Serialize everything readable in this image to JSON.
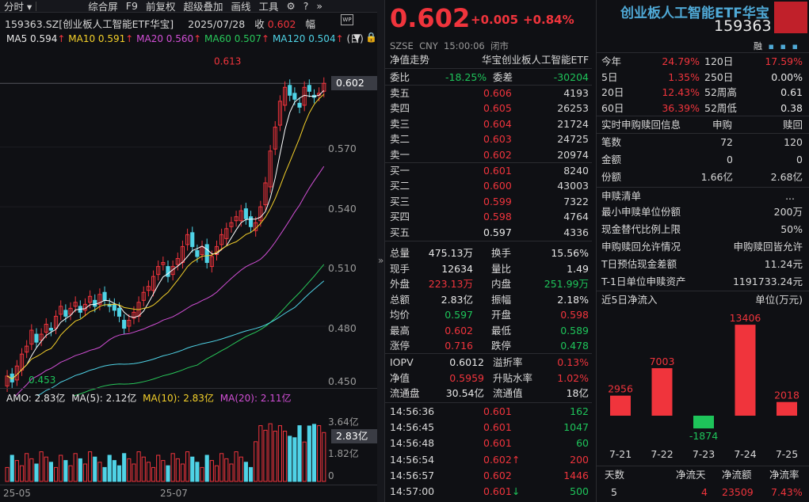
{
  "toolbar": {
    "period": "分时",
    "items": [
      "综合屏",
      "F9",
      "前复权",
      "超级叠加",
      "画线",
      "工具"
    ]
  },
  "header": {
    "code": "159363.SZ",
    "name": "[创业板人工智能ETF华宝]",
    "date": "2025/07/28",
    "close_label": "收",
    "close_value": "0.602",
    "amp_label": "幅"
  },
  "ma": {
    "ma5": "MA5 0.594",
    "ma10": "MA10 0.591",
    "ma20": "MA20 0.560",
    "ma60": "MA60 0.507",
    "ma120": "MA120 0.504",
    "unit": "日"
  },
  "amo": {
    "amo": "AMO: 2.83亿",
    "ma5": "MA(5): 2.12亿",
    "ma10": "MA(10): 2.83亿",
    "ma20": "MA(20): 2.11亿"
  },
  "price_axis": [
    "0.570",
    "0.540",
    "0.510",
    "0.480",
    "0.450"
  ],
  "current_price_box": "0.602",
  "high_marker": "0.613",
  "low_marker": "0.453",
  "vol_axis": [
    "3.64亿",
    "1.82亿",
    "0"
  ],
  "vol_box": "2.83亿",
  "date_axis": [
    "25-05",
    "25-07"
  ],
  "quote": {
    "price": "0.602",
    "change": "+0.005",
    "pct": "+0.84%",
    "exchange": "SZSE",
    "currency": "CNY",
    "time": "15:00:06",
    "status": "闭市",
    "nav_label": "净值走势",
    "nav_name": "华宝创业板人工智能ETF"
  },
  "title": {
    "name": "创业板人工智能ETF华宝",
    "code": "159363",
    "rong": "融"
  },
  "weibi": {
    "label": "委比",
    "value": "-18.25%",
    "label2": "委差",
    "value2": "-30204"
  },
  "asks": [
    {
      "l": "卖五",
      "p": "0.606",
      "v": "4193"
    },
    {
      "l": "卖四",
      "p": "0.605",
      "v": "26253"
    },
    {
      "l": "卖三",
      "p": "0.604",
      "v": "21724"
    },
    {
      "l": "卖二",
      "p": "0.603",
      "v": "24725"
    },
    {
      "l": "卖一",
      "p": "0.602",
      "v": "20974"
    }
  ],
  "bids": [
    {
      "l": "买一",
      "p": "0.601",
      "v": "8240"
    },
    {
      "l": "买二",
      "p": "0.600",
      "v": "43003"
    },
    {
      "l": "买三",
      "p": "0.599",
      "v": "7322"
    },
    {
      "l": "买四",
      "p": "0.598",
      "v": "4764"
    },
    {
      "l": "买五",
      "p": "0.597",
      "v": "4336"
    }
  ],
  "stats": [
    {
      "l1": "总量",
      "v1": "475.13万",
      "l2": "换手",
      "v2": "15.56%"
    },
    {
      "l1": "现手",
      "v1": "12634",
      "l2": "量比",
      "v2": "1.49"
    },
    {
      "l1": "外盘",
      "v1": "223.13万",
      "l2": "内盘",
      "v2": "251.99万"
    },
    {
      "l1": "总额",
      "v1": "2.83亿",
      "l2": "振幅",
      "v2": "2.18%"
    },
    {
      "l1": "均价",
      "v1": "0.597",
      "l2": "开盘",
      "v2": "0.598"
    },
    {
      "l1": "最高",
      "v1": "0.602",
      "l2": "最低",
      "v2": "0.589"
    },
    {
      "l1": "涨停",
      "v1": "0.716",
      "l2": "跌停",
      "v2": "0.478"
    }
  ],
  "iopv": [
    {
      "l1": "IOPV",
      "v1": "0.6012",
      "l2": "溢折率",
      "v2": "0.13%"
    },
    {
      "l1": "净值",
      "v1": "0.5959",
      "l2": "升贴水率",
      "v2": "1.02%"
    },
    {
      "l1": "流通盘",
      "v1": "30.54亿",
      "l2": "流通值",
      "v2": "18亿"
    }
  ],
  "ticks": [
    {
      "t": "14:56:36",
      "p": "0.601",
      "v": "162",
      "arrow": ""
    },
    {
      "t": "14:56:45",
      "p": "0.601",
      "v": "1047",
      "arrow": ""
    },
    {
      "t": "14:56:48",
      "p": "0.601",
      "v": "60",
      "arrow": ""
    },
    {
      "t": "14:56:54",
      "p": "0.602",
      "v": "200",
      "arrow": "↑"
    },
    {
      "t": "14:56:57",
      "p": "0.602",
      "v": "1446",
      "arrow": ""
    },
    {
      "t": "14:57:00",
      "p": "0.601",
      "v": "500",
      "arrow": "↓"
    }
  ],
  "perf": [
    {
      "l1": "今年",
      "v1": "24.79%",
      "l2": "120日",
      "v2": "17.59%"
    },
    {
      "l1": "5日",
      "v1": "1.35%",
      "l2": "250日",
      "v2": "0.00%"
    },
    {
      "l1": "20日",
      "v1": "12.43%",
      "l2": "52周高",
      "v2": "0.61"
    },
    {
      "l1": "60日",
      "v1": "36.39%",
      "l2": "52周低",
      "v2": "0.38"
    }
  ],
  "subred": {
    "title": "实时申购赎回信息",
    "h1": "申购",
    "h2": "赎回",
    "rows": [
      {
        "l": "笔数",
        "a": "72",
        "b": "120"
      },
      {
        "l": "金额",
        "a": "0",
        "b": "0"
      },
      {
        "l": "份额",
        "a": "1.66亿",
        "b": "2.68亿"
      }
    ]
  },
  "sulist": {
    "title": "申赎清单",
    "more": "...",
    "rows": [
      {
        "l": "最小申赎单位份额",
        "v": "200万"
      },
      {
        "l": "现金替代比例上限",
        "v": "50%"
      },
      {
        "l": "申购赎回允许情况",
        "v": "申购赎回皆允许"
      },
      {
        "l": "T日预估现金差额",
        "v": "11.24元"
      },
      {
        "l": "T-1日单位申赎资产",
        "v": "1191733.24元"
      }
    ]
  },
  "flow": {
    "title": "近5日净流入",
    "unit": "单位(万元)"
  },
  "chart_data": {
    "type": "bar",
    "categories": [
      "7-21",
      "7-22",
      "7-23",
      "7-24",
      "7-25"
    ],
    "values": [
      2956,
      7003,
      -1874,
      13406,
      2018
    ]
  },
  "flow_summary": {
    "headers": [
      "天数",
      "净流天",
      "净流额",
      "净流率"
    ],
    "values": [
      "5",
      "4",
      "23509",
      "7.43%"
    ]
  },
  "colors": {
    "up": "#f0343c",
    "down": "#1ec45a",
    "bg": "#0f1014"
  }
}
